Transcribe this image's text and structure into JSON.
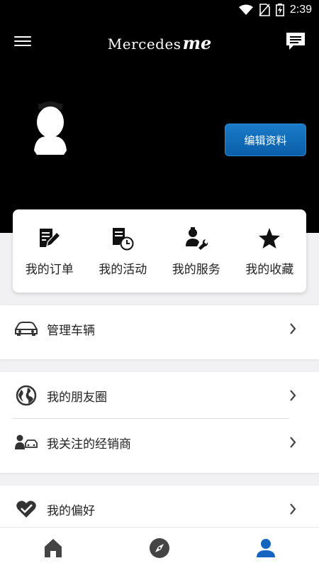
{
  "status_bar": {
    "time": "2:39"
  },
  "header": {
    "logo_text": "Mercedes",
    "logo_suffix": "me",
    "edit_profile_label": "编辑资料"
  },
  "quick_actions": [
    {
      "label": "我的订单",
      "icon": "order-edit-icon"
    },
    {
      "label": "我的活动",
      "icon": "activity-clock-icon"
    },
    {
      "label": "我的服务",
      "icon": "service-wrench-icon"
    },
    {
      "label": "我的收藏",
      "icon": "star-icon"
    }
  ],
  "menu": {
    "manage_vehicles": "管理车辆",
    "friends_circle": "我的朋友圈",
    "followed_dealers": "我关注的经销商",
    "preferences": "我的偏好"
  },
  "bottom_nav": [
    {
      "name": "home",
      "icon": "home-icon"
    },
    {
      "name": "discover",
      "icon": "compass-icon"
    },
    {
      "name": "profile",
      "icon": "user-icon",
      "active": true
    }
  ],
  "colors": {
    "accent": "#0b5ea8",
    "active_nav": "#1565c0",
    "header_bg": "#000000"
  }
}
